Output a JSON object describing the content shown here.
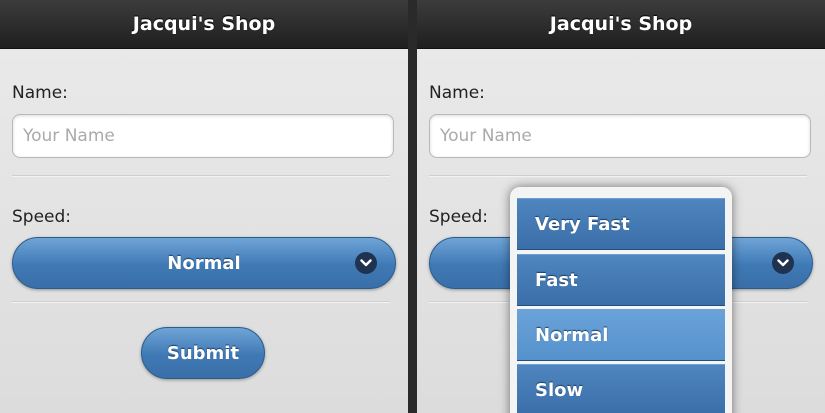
{
  "left": {
    "header_title": "Jacqui's Shop",
    "name_label": "Name:",
    "name_placeholder": "Your Name",
    "name_value": "",
    "speed_label": "Speed:",
    "speed_selected": "Normal",
    "submit_label": "Submit"
  },
  "right": {
    "header_title": "Jacqui's Shop",
    "name_label": "Name:",
    "name_placeholder": "Your Name",
    "name_value": "",
    "speed_label": "Speed:",
    "speed_options": [
      "Very Fast",
      "Fast",
      "Normal",
      "Slow"
    ],
    "selected_option": "Normal"
  },
  "icons": {
    "select_arrow": "chevron-down-icon"
  },
  "colors": {
    "header_bg": "#262626",
    "button_blue": "#4a81bd",
    "selected_option_blue": "#5f9bd2",
    "content_bg": "#e3e3e3"
  }
}
